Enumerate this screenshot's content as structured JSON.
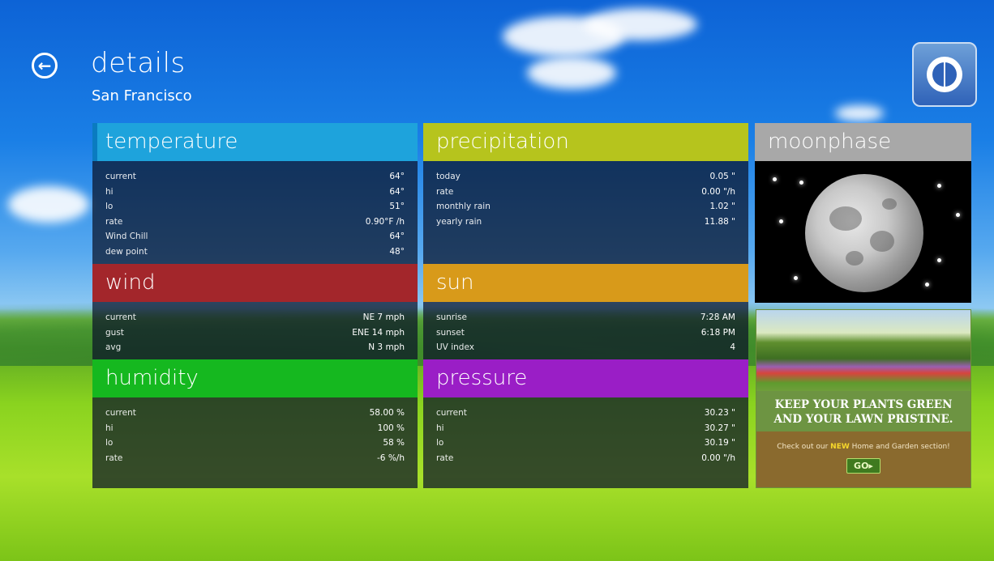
{
  "header": {
    "title": "details",
    "subtitle": "San Francisco"
  },
  "colors": {
    "temperature": "#1ea3dc",
    "precipitation": "#b6c41d",
    "moonphase": "#a8a8a8",
    "wind": "#a3262b",
    "sun": "#d89a1a",
    "humidity": "#15b81f",
    "pressure": "#9a1ec6"
  },
  "temperature": {
    "title": "temperature",
    "rows": [
      {
        "k": "current",
        "v": "64°"
      },
      {
        "k": "hi",
        "v": "64°"
      },
      {
        "k": "lo",
        "v": "51°"
      },
      {
        "k": "rate",
        "v": "0.90°F /h"
      },
      {
        "k": "Wind Chill",
        "v": "64°"
      },
      {
        "k": "dew point",
        "v": "48°"
      }
    ]
  },
  "precipitation": {
    "title": "precipitation",
    "rows": [
      {
        "k": "today",
        "v": "0.05 \""
      },
      {
        "k": "rate",
        "v": "0.00 \"/h"
      },
      {
        "k": "monthly rain",
        "v": "1.02 \""
      },
      {
        "k": "yearly rain",
        "v": "11.88 \""
      }
    ]
  },
  "moonphase": {
    "title": "moonphase"
  },
  "wind": {
    "title": "wind",
    "rows": [
      {
        "k": "current",
        "v": "NE 7 mph"
      },
      {
        "k": "gust",
        "v": "ENE 14 mph"
      },
      {
        "k": "avg",
        "v": "N 3 mph"
      }
    ]
  },
  "sun": {
    "title": "sun",
    "rows": [
      {
        "k": "sunrise",
        "v": "7:28 AM"
      },
      {
        "k": "sunset",
        "v": "6:18 PM"
      },
      {
        "k": "UV index",
        "v": "4"
      }
    ]
  },
  "humidity": {
    "title": "humidity",
    "rows": [
      {
        "k": "current",
        "v": "58.00 %"
      },
      {
        "k": "hi",
        "v": "100 %"
      },
      {
        "k": "lo",
        "v": "58 %"
      },
      {
        "k": "rate",
        "v": "-6 %/h"
      }
    ]
  },
  "pressure": {
    "title": "pressure",
    "rows": [
      {
        "k": "current",
        "v": "30.23 \""
      },
      {
        "k": "hi",
        "v": "30.27 \""
      },
      {
        "k": "lo",
        "v": "30.19 \""
      },
      {
        "k": "rate",
        "v": "0.00 \"/h"
      }
    ]
  },
  "ad": {
    "headline_1": "KEEP YOUR PLANTS GREEN",
    "headline_2": "AND YOUR LAWN PRISTINE.",
    "text_pre": "Check out our",
    "text_new": "NEW",
    "text_post": "Home and Garden section!",
    "button": "GO▸"
  }
}
